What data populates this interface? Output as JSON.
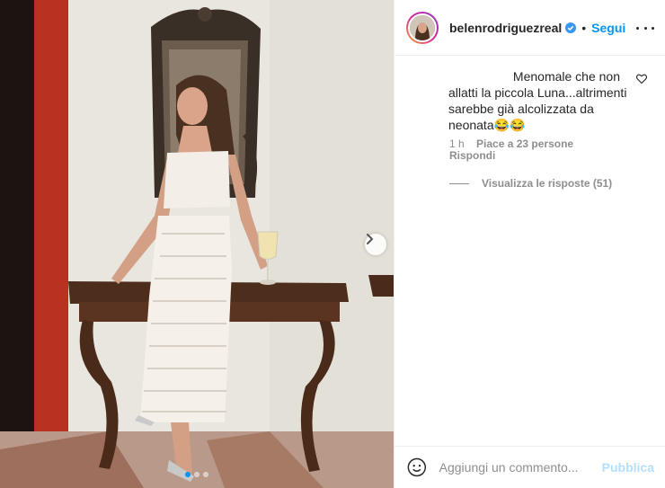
{
  "post": {
    "username": "belenrodriguezreal",
    "separator": "•",
    "follow_label": "Segui"
  },
  "comment": {
    "text_line1": "Menomale che non",
    "text_rest": "allatti la piccola Luna...altrimenti sarebbe già alcolizzata da neonata😂😂",
    "time": "1 h",
    "likes": "Piace a 23 persone",
    "reply_label": "Rispondi",
    "view_replies": "Visualizza le risposte (51)"
  },
  "composer": {
    "placeholder": "Aggiungi un commento...",
    "publish_label": "Pubblica"
  },
  "carousel": {
    "slides": 3,
    "active_index": 0
  },
  "colors": {
    "accent": "#0095f6",
    "publish_disabled": "#b2dffc",
    "muted_text": "#8e8e8e",
    "primary_text": "#262626"
  },
  "icons": [
    "verified-badge-icon",
    "more-options-icon",
    "heart-icon",
    "chevron-right-icon",
    "emoji-icon"
  ]
}
